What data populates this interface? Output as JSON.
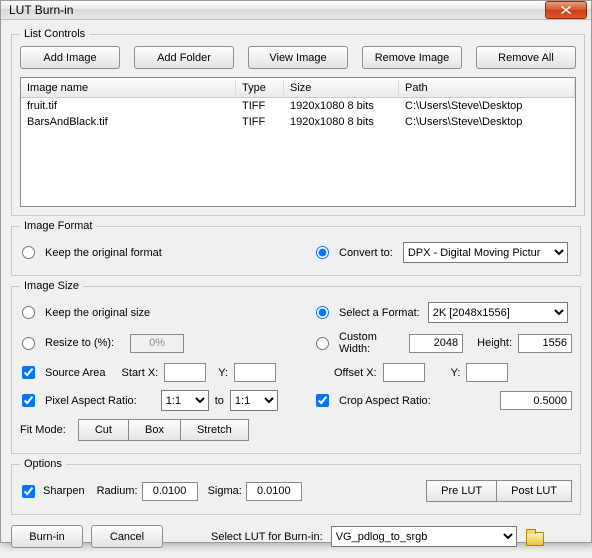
{
  "window": {
    "title": "LUT Burn-in"
  },
  "listControls": {
    "legend": "List Controls",
    "buttons": {
      "addImage": "Add Image",
      "addFolder": "Add Folder",
      "viewImage": "View Image",
      "removeImage": "Remove Image",
      "removeAll": "Remove All"
    },
    "columns": {
      "name": "Image name",
      "type": "Type",
      "size": "Size",
      "path": "Path"
    },
    "rows": [
      {
        "name": "fruit.tif",
        "type": "TIFF",
        "size": "1920x1080 8 bits",
        "path": "C:\\Users\\Steve\\Desktop"
      },
      {
        "name": "BarsAndBlack.tif",
        "type": "TIFF",
        "size": "1920x1080 8 bits",
        "path": "C:\\Users\\Steve\\Desktop"
      }
    ]
  },
  "imageFormat": {
    "legend": "Image Format",
    "keepOriginal": "Keep the original format",
    "convertTo": "Convert to:",
    "convertSelected": true,
    "format": "DPX - Digital Moving Pictur"
  },
  "imageSize": {
    "legend": "Image Size",
    "keepOriginal": "Keep the original size",
    "resizeTo": "Resize to (%):",
    "resizeValue": "0%",
    "selectFormat": "Select a Format:",
    "selectFormatSelected": true,
    "formatValue": "2K [2048x1556]",
    "customWidth": "Custom Width:",
    "customWidthValue": "2048",
    "heightLabel": "Height:",
    "heightValue": "1556",
    "sourceArea": "Source Area",
    "startX": "Start X:",
    "startXValue": "",
    "yLabel": "Y:",
    "startYValue": "",
    "offsetX": "Offset X:",
    "offsetXValue": "",
    "offsetYValue": "",
    "pixelAspect": "Pixel Aspect Ratio:",
    "par1": "1:1",
    "toLabel": "to",
    "par2": "1:1",
    "cropAspect": "Crop Aspect Ratio:",
    "cropValue": "0.5000",
    "fitMode": "Fit Mode:",
    "fitCut": "Cut",
    "fitBox": "Box",
    "fitStretch": "Stretch"
  },
  "options": {
    "legend": "Options",
    "sharpen": "Sharpen",
    "radium": "Radium:",
    "radiumValue": "0.0100",
    "sigma": "Sigma:",
    "sigmaValue": "0.0100",
    "preLUT": "Pre LUT",
    "postLUT": "Post LUT"
  },
  "bottom": {
    "burnIn": "Burn-in",
    "cancel": "Cancel",
    "selectLUT": "Select LUT for Burn-in:",
    "lutValue": "VG_pdlog_to_srgb"
  }
}
